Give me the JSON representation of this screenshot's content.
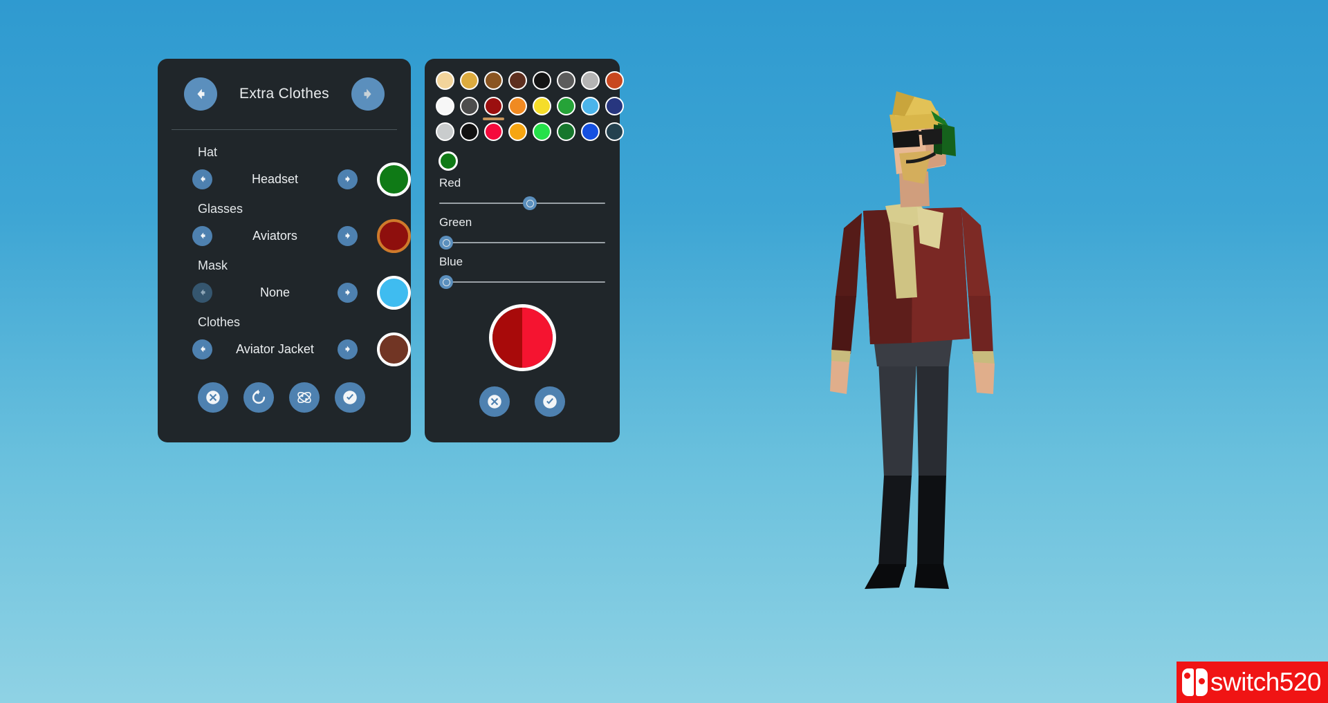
{
  "header": {
    "title": "Extra Clothes",
    "prev_icon": "arrow-left-icon",
    "next_icon": "arrow-right-icon"
  },
  "options": [
    {
      "label": "Hat",
      "value": "Headset",
      "color": "#0f7a16",
      "color_active": false,
      "prev_enabled": true,
      "next_enabled": true
    },
    {
      "label": "Glasses",
      "value": "Aviators",
      "color": "#8e0f0d",
      "color_active": true,
      "prev_enabled": true,
      "next_enabled": true
    },
    {
      "label": "Mask",
      "value": "None",
      "color": "#3fbcf0",
      "color_active": false,
      "prev_enabled": false,
      "next_enabled": true
    },
    {
      "label": "Clothes",
      "value": "Aviator Jacket",
      "color": "#713524",
      "color_active": false,
      "prev_enabled": true,
      "next_enabled": true
    }
  ],
  "left_actions": [
    {
      "name": "cancel-button",
      "icon": "circle-x-icon"
    },
    {
      "name": "reset-button",
      "icon": "refresh-icon"
    },
    {
      "name": "randomize-button",
      "icon": "atom-icon"
    },
    {
      "name": "confirm-button",
      "icon": "circle-check-icon"
    }
  ],
  "color_picker": {
    "palette": [
      [
        "#f2d49b",
        "#dcab3f",
        "#8a5521",
        "#5e2f1f",
        "#141414",
        "#5c5c5c",
        "#b4b4b4",
        "#c8471f"
      ],
      [
        "#f7f7f7",
        "#4d4d4d",
        "#9b0f0f",
        "#f08a22",
        "#f5dd2a",
        "#26a338",
        "#4bb4ea",
        "#27367f"
      ],
      [
        "#c9cccd",
        "#111111",
        "#f50a3c",
        "#f5a512",
        "#25e04a",
        "#16772c",
        "#1550e0",
        "#24414f"
      ]
    ],
    "selected_row": 1,
    "selected_col": 2,
    "current_color": "#0f7a16",
    "sliders": [
      {
        "label": "Red",
        "value": 55
      },
      {
        "label": "Green",
        "value": 0
      },
      {
        "label": "Blue",
        "value": 0
      }
    ],
    "preview_old": "#a80a0a",
    "preview_new": "#f51430",
    "actions": [
      {
        "name": "color-cancel-button",
        "icon": "circle-x-icon"
      },
      {
        "name": "color-confirm-button",
        "icon": "circle-check-icon"
      }
    ]
  },
  "watermark": {
    "text": "switch520"
  },
  "character": {
    "hair_color": "#d9b64a",
    "skin_color": "#e8b894",
    "headset_color": "#15621c",
    "glasses_color": "#141414",
    "scarf_color": "#d7cd8e",
    "jacket_color": "#6e2420",
    "pants_color": "#2a2d33"
  }
}
